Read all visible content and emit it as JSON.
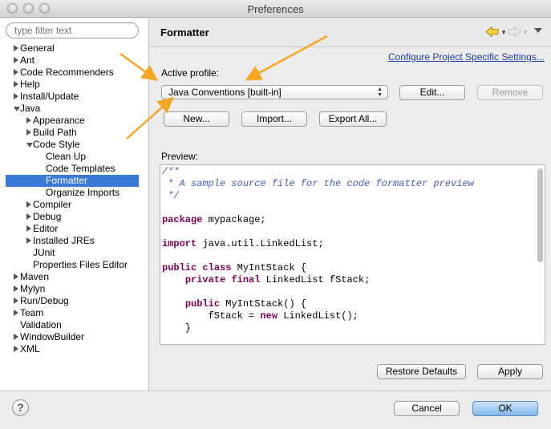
{
  "window": {
    "title": "Preferences"
  },
  "sidebar": {
    "filter_placeholder": "type filter text",
    "items": [
      {
        "label": "General",
        "twisty": "right",
        "level": 0
      },
      {
        "label": "Ant",
        "twisty": "right",
        "level": 0
      },
      {
        "label": "Code Recommenders",
        "twisty": "right",
        "level": 0
      },
      {
        "label": "Help",
        "twisty": "right",
        "level": 0
      },
      {
        "label": "Install/Update",
        "twisty": "right",
        "level": 0
      },
      {
        "label": "Java",
        "twisty": "down",
        "level": 0
      },
      {
        "label": "Appearance",
        "twisty": "right",
        "level": 1
      },
      {
        "label": "Build Path",
        "twisty": "right",
        "level": 1
      },
      {
        "label": "Code Style",
        "twisty": "down",
        "level": 1
      },
      {
        "label": "Clean Up",
        "twisty": "none",
        "level": 2
      },
      {
        "label": "Code Templates",
        "twisty": "none",
        "level": 2
      },
      {
        "label": "Formatter",
        "twisty": "none",
        "level": 2,
        "selected": true
      },
      {
        "label": "Organize Imports",
        "twisty": "none",
        "level": 2
      },
      {
        "label": "Compiler",
        "twisty": "right",
        "level": 1
      },
      {
        "label": "Debug",
        "twisty": "right",
        "level": 1
      },
      {
        "label": "Editor",
        "twisty": "right",
        "level": 1
      },
      {
        "label": "Installed JREs",
        "twisty": "right",
        "level": 1
      },
      {
        "label": "JUnit",
        "twisty": "none",
        "level": 1
      },
      {
        "label": "Properties Files Editor",
        "twisty": "none",
        "level": 1
      },
      {
        "label": "Maven",
        "twisty": "right",
        "level": 0
      },
      {
        "label": "Mylyn",
        "twisty": "right",
        "level": 0
      },
      {
        "label": "Run/Debug",
        "twisty": "right",
        "level": 0
      },
      {
        "label": "Team",
        "twisty": "right",
        "level": 0
      },
      {
        "label": "Validation",
        "twisty": "none",
        "level": 0
      },
      {
        "label": "WindowBuilder",
        "twisty": "right",
        "level": 0
      },
      {
        "label": "XML",
        "twisty": "right",
        "level": 0
      }
    ]
  },
  "panel": {
    "title": "Formatter",
    "configure_link": "Configure Project Specific Settings...",
    "active_profile_label": "Active profile:",
    "profile_value": "Java Conventions [built-in]",
    "edit_label": "Edit...",
    "remove_label": "Remove",
    "new_label": "New...",
    "import_label": "Import...",
    "export_label": "Export All...",
    "preview_label": "Preview:",
    "preview_lines": [
      [
        {
          "t": "/**",
          "c": "comment"
        }
      ],
      [
        {
          "t": " * A sample source file for the code formatter preview",
          "c": "comment"
        }
      ],
      [
        {
          "t": " */",
          "c": "comment"
        }
      ],
      [],
      [
        {
          "t": "package",
          "c": "kw"
        },
        {
          "t": " mypackage;",
          "c": ""
        }
      ],
      [],
      [
        {
          "t": "import",
          "c": "kw"
        },
        {
          "t": " java.util.LinkedList;",
          "c": ""
        }
      ],
      [],
      [
        {
          "t": "public",
          "c": "kw"
        },
        {
          "t": " ",
          "c": ""
        },
        {
          "t": "class",
          "c": "kw"
        },
        {
          "t": " MyIntStack {",
          "c": ""
        }
      ],
      [
        {
          "t": "    ",
          "c": ""
        },
        {
          "t": "private",
          "c": "kw"
        },
        {
          "t": " ",
          "c": ""
        },
        {
          "t": "final",
          "c": "kw"
        },
        {
          "t": " LinkedList fStack;",
          "c": ""
        }
      ],
      [],
      [
        {
          "t": "    ",
          "c": ""
        },
        {
          "t": "public",
          "c": "kw"
        },
        {
          "t": " MyIntStack() {",
          "c": ""
        }
      ],
      [
        {
          "t": "        fStack = ",
          "c": ""
        },
        {
          "t": "new",
          "c": "kw"
        },
        {
          "t": " LinkedList();",
          "c": ""
        }
      ],
      [
        {
          "t": "    }",
          "c": ""
        }
      ]
    ],
    "restore_defaults_label": "Restore Defaults",
    "apply_label": "Apply"
  },
  "footer": {
    "help_icon": "?",
    "cancel_label": "Cancel",
    "ok_label": "OK"
  },
  "colors": {
    "selection": "#3b79d6",
    "link": "#1a3fa8",
    "annotation_arrow": "#f5a623",
    "comment": "#3f5fbf",
    "keyword": "#7f0055"
  }
}
